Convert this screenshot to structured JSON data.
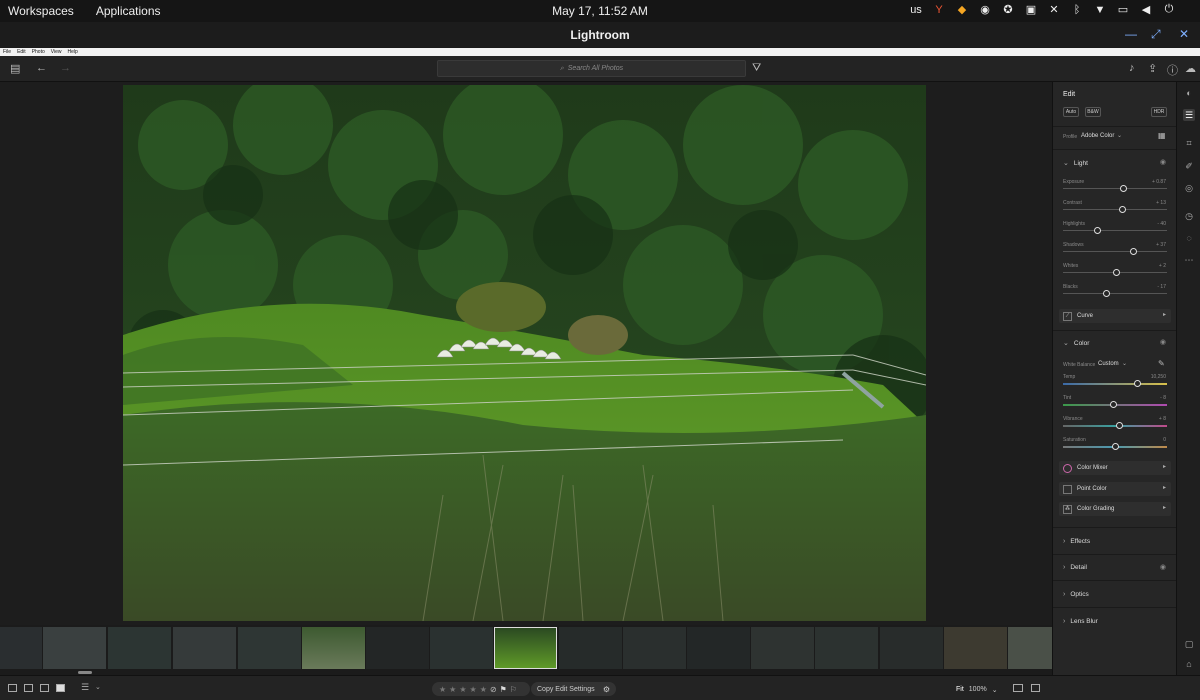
{
  "topbar": {
    "workspaces": "Workspaces",
    "applications": "Applications",
    "clock": "May 17, 11:52 AM",
    "keyboard": "us"
  },
  "titlebar": {
    "title": "Lightroom"
  },
  "menu": [
    "File",
    "Edit",
    "Photo",
    "View",
    "Help"
  ],
  "toolbar": {
    "search_placeholder": "Search All Photos"
  },
  "edit_panel": {
    "title": "Edit",
    "buttons": {
      "auto": "Auto",
      "bw": "B&W",
      "hdr": "HDR"
    },
    "profile_label": "Profile",
    "profile_value": "Adobe Color",
    "light": {
      "label": "Light",
      "sliders": [
        {
          "name": "Exposure",
          "value": "+ 0.87",
          "position": 0.58
        },
        {
          "name": "Contrast",
          "value": "+ 13",
          "position": 0.57
        },
        {
          "name": "Highlights",
          "value": "- 40",
          "position": 0.33
        },
        {
          "name": "Shadows",
          "value": "+ 37",
          "position": 0.68
        },
        {
          "name": "Whites",
          "value": "+ 2",
          "position": 0.51
        },
        {
          "name": "Blacks",
          "value": "- 17",
          "position": 0.42
        }
      ],
      "curve": "Curve"
    },
    "color": {
      "label": "Color",
      "white_balance_label": "White Balance",
      "white_balance_value": "Custom",
      "sliders": [
        {
          "name": "Temp",
          "value": "10,250",
          "position": 0.72
        },
        {
          "name": "Tint",
          "value": "- 8",
          "position": 0.49
        },
        {
          "name": "Vibrance",
          "value": "+ 8",
          "position": 0.54
        },
        {
          "name": "Saturation",
          "value": "0",
          "position": 0.5
        }
      ],
      "color_mixer": "Color Mixer",
      "point_color": "Point Color",
      "color_grading": "Color Grading"
    },
    "sections": [
      "Effects",
      "Detail",
      "Optics",
      "Lens Blur"
    ]
  },
  "bottombar": {
    "copy_edit_settings": "Copy Edit Settings",
    "fit": "Fit",
    "zoom": "100%"
  },
  "colors": {
    "panel_bg": "#262626",
    "canvas_bg": "#1d1d1d",
    "window_control": "#7fb0ff"
  }
}
